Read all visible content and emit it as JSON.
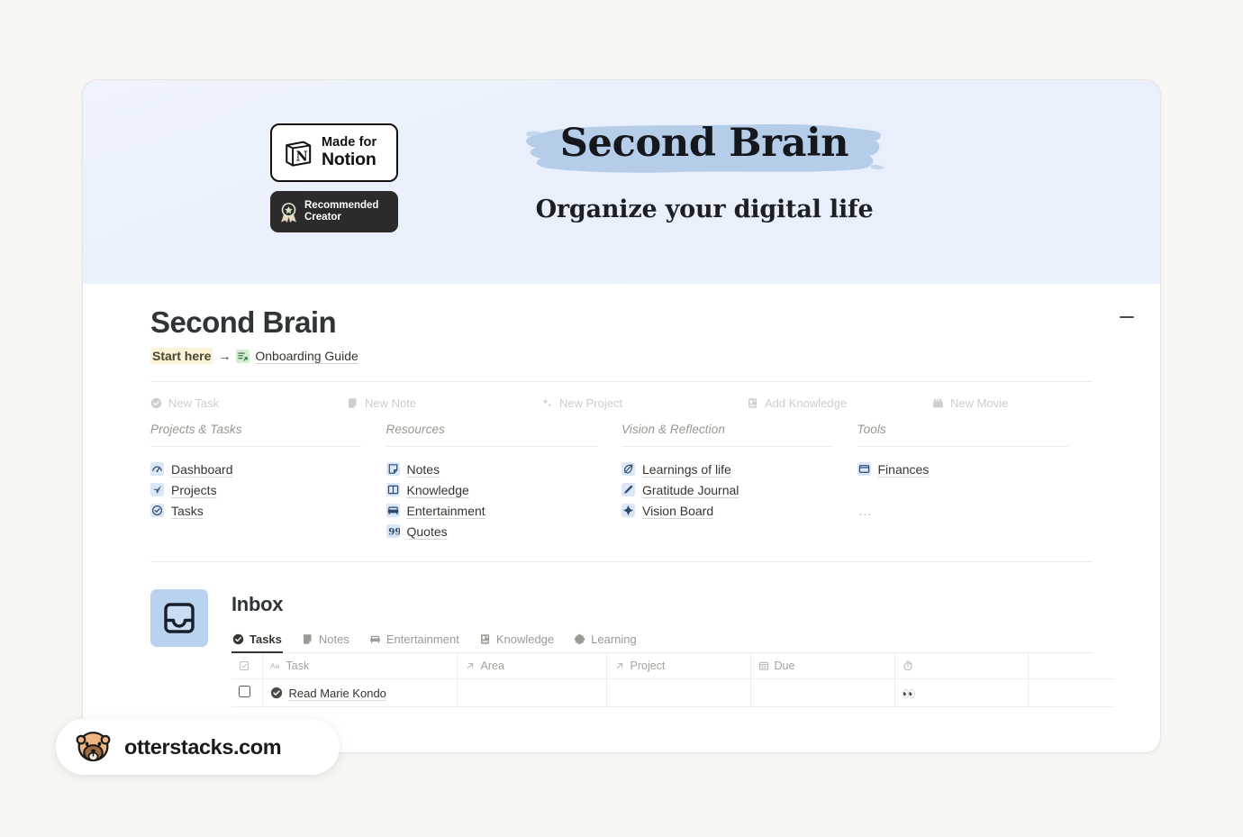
{
  "cover": {
    "badge_notion": {
      "line1": "Made for",
      "line2": "Notion",
      "icon": "notion-cube-icon"
    },
    "badge_creator": {
      "line1": "Recommended",
      "line2": "Creator",
      "icon": "award-rosette-icon"
    },
    "title": "Second Brain",
    "subtitle": "Organize your digital life",
    "highlight_color": "#b6cdea",
    "background_color": "#eaf1fc"
  },
  "header": {
    "page_title": "Second Brain",
    "start_here": "Start here",
    "arrow": "→",
    "guide_link": "Onboarding Guide",
    "guide_icon": "list-arrow-icon",
    "minimize_icon": "minimize-icon"
  },
  "quick_buttons": [
    {
      "label": "New Task",
      "icon": "check-circle-icon"
    },
    {
      "label": "New Note",
      "icon": "note-icon"
    },
    {
      "label": "New Project",
      "icon": "sparkles-icon"
    },
    {
      "label": "Add Knowledge",
      "icon": "book-icon"
    },
    {
      "label": "New Movie",
      "icon": "clapperboard-icon"
    }
  ],
  "columns": [
    {
      "title": "Projects & Tasks",
      "links": [
        {
          "label": "Dashboard",
          "icon": "gauge-icon"
        },
        {
          "label": "Projects",
          "icon": "paper-plane-icon"
        },
        {
          "label": "Tasks",
          "icon": "check-circle-icon"
        }
      ],
      "more": ""
    },
    {
      "title": "Resources",
      "links": [
        {
          "label": "Notes",
          "icon": "note-icon"
        },
        {
          "label": "Knowledge",
          "icon": "open-book-icon"
        },
        {
          "label": "Entertainment",
          "icon": "sofa-icon"
        },
        {
          "label": "Quotes",
          "icon": "quote-icon"
        }
      ],
      "more": ""
    },
    {
      "title": "Vision & Reflection",
      "links": [
        {
          "label": "Learnings of life",
          "icon": "leaf-icon"
        },
        {
          "label": "Gratitude Journal",
          "icon": "pen-icon"
        },
        {
          "label": "Vision Board",
          "icon": "compass-icon"
        }
      ],
      "more": ""
    },
    {
      "title": "Tools",
      "links": [
        {
          "label": "Finances",
          "icon": "wallet-icon"
        }
      ],
      "more": "..."
    }
  ],
  "inbox": {
    "icon": "inbox-tray-icon",
    "title": "Inbox",
    "tabs": [
      {
        "label": "Tasks",
        "icon": "check-circle-icon",
        "active": true
      },
      {
        "label": "Notes",
        "icon": "note-icon",
        "active": false
      },
      {
        "label": "Entertainment",
        "icon": "sofa-icon",
        "active": false
      },
      {
        "label": "Knowledge",
        "icon": "book-icon",
        "active": false
      },
      {
        "label": "Learning",
        "icon": "gear-flower-icon",
        "active": false
      }
    ],
    "table": {
      "headers": [
        {
          "label": "",
          "icon": "checkbox-header-icon"
        },
        {
          "label": "Task",
          "icon": "aa-text-icon"
        },
        {
          "label": "Area",
          "icon": "relation-arrow-icon"
        },
        {
          "label": "Project",
          "icon": "relation-arrow-icon"
        },
        {
          "label": "Due",
          "icon": "calendar-icon"
        },
        {
          "label": "",
          "icon": "stopwatch-icon"
        },
        {
          "label": "",
          "icon": ""
        }
      ],
      "rows": [
        {
          "checked": false,
          "task": "Read Marie Kondo",
          "task_icon": "check-circle-icon",
          "area": "",
          "project": "",
          "due": "",
          "timer": "👀",
          "extra": ""
        }
      ]
    }
  },
  "watermark": {
    "text": "otterstacks.com",
    "icon": "otter-logo-icon"
  }
}
